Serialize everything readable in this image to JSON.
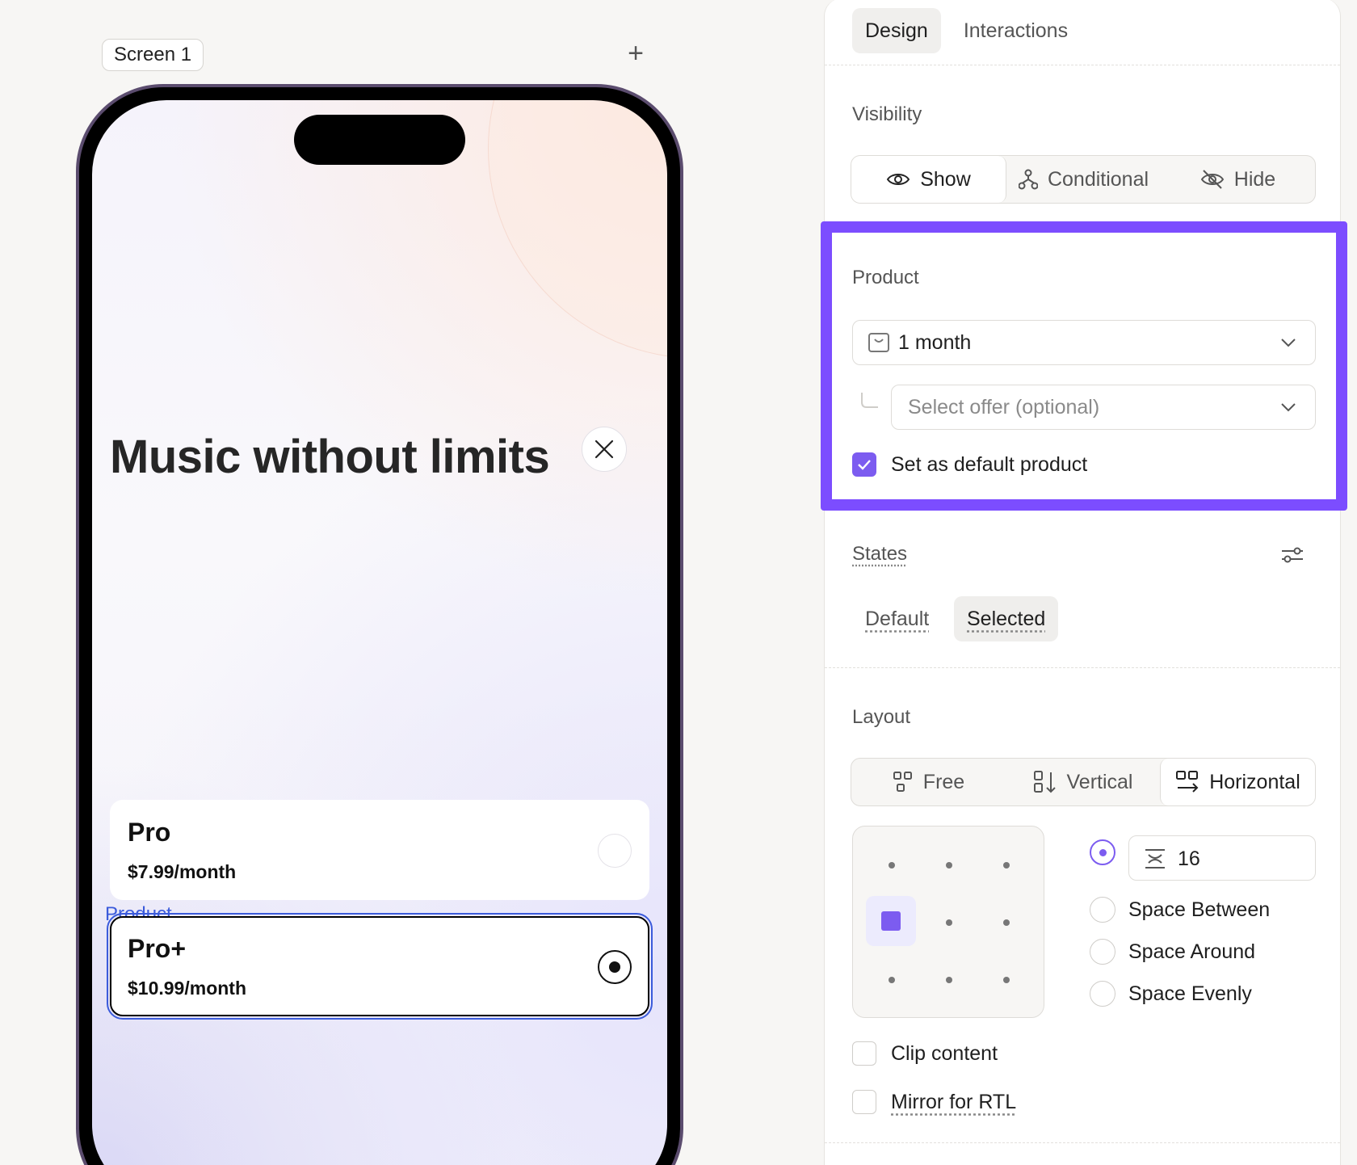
{
  "canvas": {
    "screen_label": "Screen 1",
    "add_label": "+"
  },
  "phone": {
    "title": "Music without limits",
    "product_tag": "Product",
    "plans": [
      {
        "name": "Pro",
        "price": "$7.99/month",
        "selected": false
      },
      {
        "name": "Pro+",
        "price": "$10.99/month",
        "selected": true
      }
    ]
  },
  "panel": {
    "tabs": [
      {
        "label": "Design",
        "active": true
      },
      {
        "label": "Interactions",
        "active": false
      }
    ],
    "visibility": {
      "label": "Visibility",
      "options": [
        {
          "label": "Show",
          "icon": "eye-icon",
          "active": true
        },
        {
          "label": "Conditional",
          "icon": "branch-icon",
          "active": false
        },
        {
          "label": "Hide",
          "icon": "eye-off-icon",
          "active": false
        }
      ]
    },
    "product": {
      "label": "Product",
      "selected_value": "1 month",
      "offer_placeholder": "Select offer (optional)",
      "default_checkbox_label": "Set as default product",
      "default_checked": true
    },
    "states": {
      "label": "States",
      "options": [
        {
          "label": "Default",
          "active": false
        },
        {
          "label": "Selected",
          "active": true
        }
      ]
    },
    "layout": {
      "label": "Layout",
      "modes": [
        {
          "label": "Free",
          "active": false
        },
        {
          "label": "Vertical",
          "active": false
        },
        {
          "label": "Horizontal",
          "active": true
        }
      ],
      "gap_value": "16",
      "distribution": [
        {
          "label": "Space Between",
          "selected": false
        },
        {
          "label": "Space Around",
          "selected": false
        },
        {
          "label": "Space Evenly",
          "selected": false
        }
      ],
      "clip_content_label": "Clip content",
      "mirror_rtl_label": "Mirror for RTL"
    }
  },
  "colors": {
    "accent": "#7c4dff",
    "checkbox_fill": "#7c5cf0",
    "canvas_selection": "#3b5bdb"
  }
}
